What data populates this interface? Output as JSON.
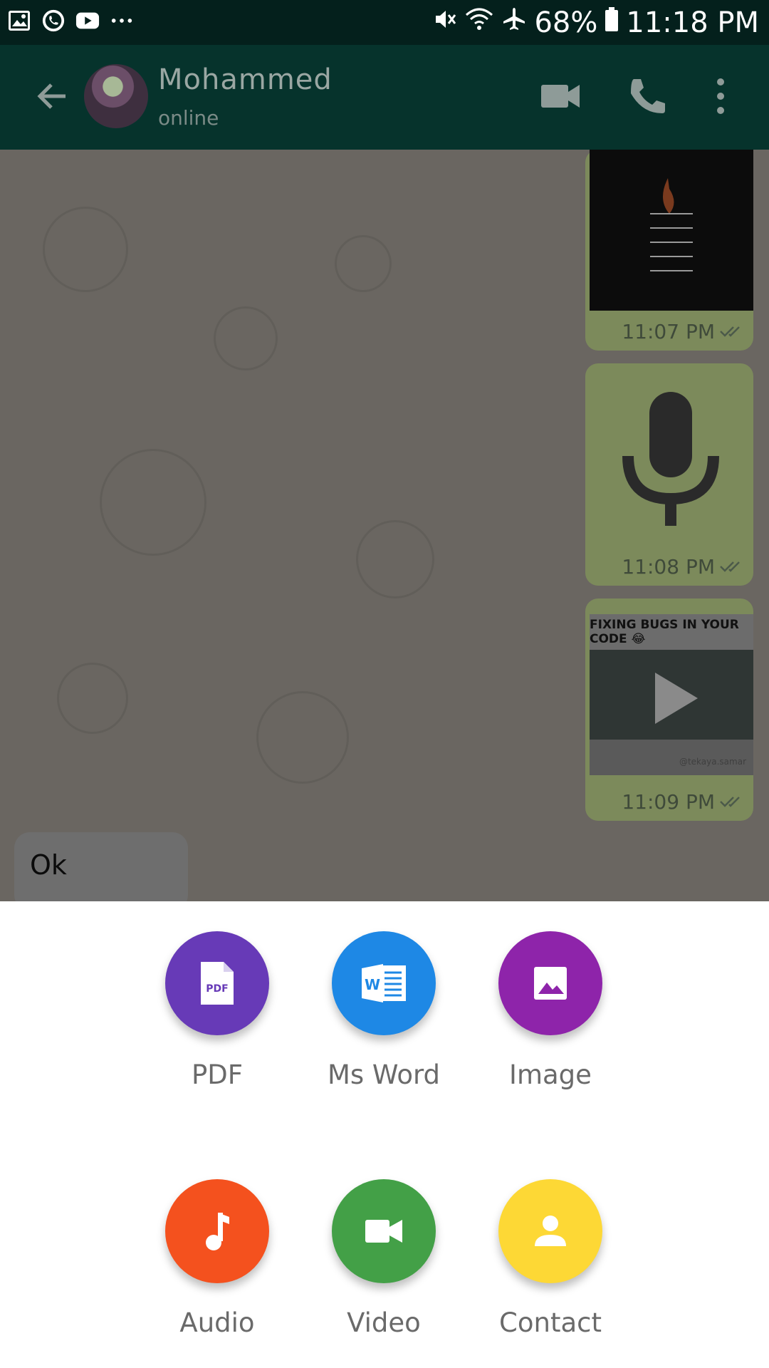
{
  "status_bar": {
    "icons_left": [
      "gallery-icon",
      "whatsapp-icon",
      "youtube-icon",
      "more-notifications-icon"
    ],
    "battery": "68%",
    "time": "11:18 PM"
  },
  "header": {
    "contact_name": "Mohammed",
    "status": "online"
  },
  "messages": [
    {
      "type": "image",
      "time": "11:07 PM"
    },
    {
      "type": "audio",
      "time": "11:08 PM"
    },
    {
      "type": "video",
      "caption": "FIXING BUGS IN YOUR CODE 😂",
      "watermark": "@tekaya.samar",
      "time": "11:09 PM"
    },
    {
      "type": "text",
      "text": "Ok"
    }
  ],
  "attach_sheet": {
    "options": [
      {
        "label": "PDF",
        "color": "#673ab7",
        "icon": "pdf-icon"
      },
      {
        "label": "Ms Word",
        "color": "#1e88e5",
        "icon": "word-icon"
      },
      {
        "label": "Image",
        "color": "#8e24aa",
        "icon": "image-icon"
      },
      {
        "label": "Audio",
        "color": "#f4511e",
        "icon": "music-note-icon"
      },
      {
        "label": "Video",
        "color": "#43a047",
        "icon": "videocam-icon"
      },
      {
        "label": "Contact",
        "color": "#fdd835",
        "icon": "person-icon"
      }
    ]
  }
}
